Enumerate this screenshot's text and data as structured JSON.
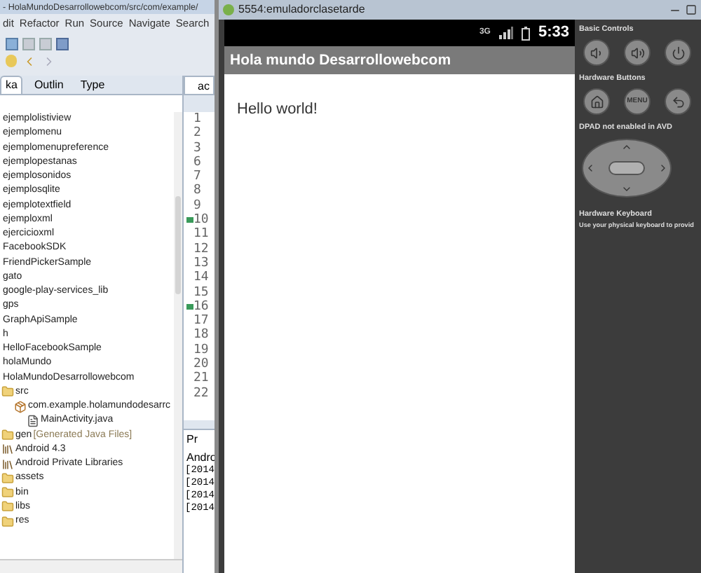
{
  "eclipse": {
    "title": "- HolaMundoDesarrollowebcom/src/com/example/",
    "menu": [
      "dit",
      "Refactor",
      "Run",
      "Source",
      "Navigate",
      "Search"
    ],
    "view_tabs": [
      {
        "label": "ka",
        "selected": true
      },
      {
        "label": "Outlin",
        "selected": false
      },
      {
        "label": "Type",
        "selected": false
      }
    ],
    "tree": [
      {
        "label": "ejemplolistiview"
      },
      {
        "label": "ejemplomenu"
      },
      {
        "label": "ejemplomenupreference"
      },
      {
        "label": "ejemplopestanas"
      },
      {
        "label": "ejemplosonidos"
      },
      {
        "label": "ejemplosqlite"
      },
      {
        "label": "ejemplotextfield"
      },
      {
        "label": "ejemploxml"
      },
      {
        "label": "ejercicioxml"
      },
      {
        "label": "FacebookSDK"
      },
      {
        "label": "FriendPickerSample"
      },
      {
        "label": "gato"
      },
      {
        "label": "google-play-services_lib"
      },
      {
        "label": "gps"
      },
      {
        "label": "GraphApiSample"
      },
      {
        "label": "h"
      },
      {
        "label": "HelloFacebookSample"
      },
      {
        "label": "holaMundo"
      },
      {
        "label": "HolaMundoDesarrollowebcom",
        "children": [
          {
            "label": "src",
            "kind": "folder",
            "children": [
              {
                "label": "com.example.holamundodesarrc",
                "kind": "package",
                "children": [
                  {
                    "label": "MainActivity.java",
                    "kind": "file"
                  }
                ]
              }
            ]
          },
          {
            "label": "gen",
            "kind": "folder",
            "note": "[Generated Java Files]"
          },
          {
            "label": "Android 4.3",
            "kind": "library"
          },
          {
            "label": "Android Private Libraries",
            "kind": "library"
          },
          {
            "label": "assets",
            "kind": "folder"
          },
          {
            "label": "bin",
            "kind": "folder"
          },
          {
            "label": "libs",
            "kind": "folder"
          },
          {
            "label": "res",
            "kind": "folder"
          }
        ]
      }
    ],
    "editor": {
      "tab": "ac",
      "lines": [
        {
          "number": "1",
          "marker": false
        },
        {
          "number": "2",
          "marker": false
        },
        {
          "number": "3",
          "marker": false
        },
        {
          "number": "6",
          "marker": false
        },
        {
          "number": "7",
          "marker": false
        },
        {
          "number": "8",
          "marker": false
        },
        {
          "number": "9",
          "marker": false
        },
        {
          "number": "10",
          "marker": true
        },
        {
          "number": "11",
          "marker": false
        },
        {
          "number": "12",
          "marker": false
        },
        {
          "number": "13",
          "marker": false
        },
        {
          "number": "14",
          "marker": false
        },
        {
          "number": "15",
          "marker": false
        },
        {
          "number": "16",
          "marker": true
        },
        {
          "number": "17",
          "marker": false
        },
        {
          "number": "18",
          "marker": false
        },
        {
          "number": "19",
          "marker": false
        },
        {
          "number": "20",
          "marker": false
        },
        {
          "number": "21",
          "marker": false
        },
        {
          "number": "22",
          "marker": false
        }
      ]
    },
    "console": {
      "tab": "Pr",
      "label": "Andro",
      "lines": [
        "[2014",
        "[2014",
        "[2014",
        "[2014"
      ]
    }
  },
  "emulator": {
    "title": "5554:emuladorclasetarde",
    "status": {
      "network": "3G",
      "time": "5:33"
    },
    "app_title": "Hola mundo Desarrollowebcom",
    "content": "Hello world!",
    "controls": {
      "basic_label": "Basic Controls",
      "hardware_label": "Hardware Buttons",
      "menu_button": "MENU",
      "dpad_label": "DPAD not enabled in AVD",
      "keyboard_label": "Hardware Keyboard",
      "keyboard_hint": "Use your physical keyboard to provid"
    }
  }
}
